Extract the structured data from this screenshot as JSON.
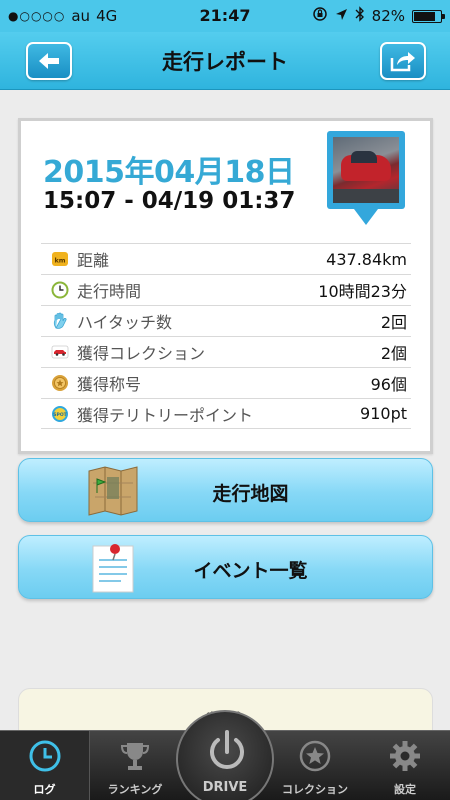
{
  "status_bar": {
    "signal": "●○○○○",
    "carrier": "au",
    "network": "4G",
    "time": "21:47",
    "battery_percent": "82%",
    "battery_level": 0.82
  },
  "nav": {
    "title": "走行レポート",
    "back_icon": "arrow-left-icon",
    "share_icon": "share-icon"
  },
  "report": {
    "date": "2015年04月18日",
    "time_range": "15:07 - 04/19 01:37",
    "stats": [
      {
        "icon": "km-icon",
        "label": "距離",
        "value": "437.84km"
      },
      {
        "icon": "clock-icon",
        "label": "走行時間",
        "value": "10時間23分"
      },
      {
        "icon": "hand-icon",
        "label": "ハイタッチ数",
        "value": "2回"
      },
      {
        "icon": "car-icon",
        "label": "獲得コレクション",
        "value": "2個"
      },
      {
        "icon": "medal-icon",
        "label": "獲得称号",
        "value": "96個"
      },
      {
        "icon": "spot-icon",
        "label": "獲得テリトリーポイント",
        "value": "910pt"
      }
    ]
  },
  "buttons": {
    "map_label": "走行地図",
    "events_label": "イベント一覧",
    "delete_label": "削除"
  },
  "tabs": {
    "log": "ログ",
    "ranking": "ランキング",
    "drive": "DRIVE",
    "collection": "コレクション",
    "settings": "設定"
  },
  "colors": {
    "accent": "#35a9d5",
    "nav_bg": "#3fc0e8",
    "button_bg": "#86d8f6"
  }
}
